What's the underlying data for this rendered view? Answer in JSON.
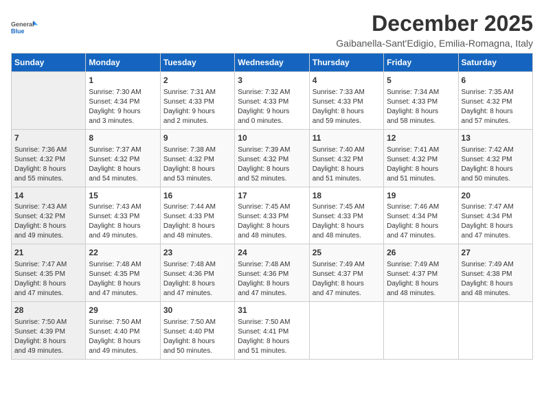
{
  "logo": {
    "line1": "General",
    "line2": "Blue"
  },
  "title": "December 2025",
  "subtitle": "Gaibanella-Sant'Edigio, Emilia-Romagna, Italy",
  "days_of_week": [
    "Sunday",
    "Monday",
    "Tuesday",
    "Wednesday",
    "Thursday",
    "Friday",
    "Saturday"
  ],
  "weeks": [
    [
      {
        "day": "",
        "info": ""
      },
      {
        "day": "1",
        "info": "Sunrise: 7:30 AM\nSunset: 4:34 PM\nDaylight: 9 hours\nand 3 minutes."
      },
      {
        "day": "2",
        "info": "Sunrise: 7:31 AM\nSunset: 4:33 PM\nDaylight: 9 hours\nand 2 minutes."
      },
      {
        "day": "3",
        "info": "Sunrise: 7:32 AM\nSunset: 4:33 PM\nDaylight: 9 hours\nand 0 minutes."
      },
      {
        "day": "4",
        "info": "Sunrise: 7:33 AM\nSunset: 4:33 PM\nDaylight: 8 hours\nand 59 minutes."
      },
      {
        "day": "5",
        "info": "Sunrise: 7:34 AM\nSunset: 4:33 PM\nDaylight: 8 hours\nand 58 minutes."
      },
      {
        "day": "6",
        "info": "Sunrise: 7:35 AM\nSunset: 4:32 PM\nDaylight: 8 hours\nand 57 minutes."
      }
    ],
    [
      {
        "day": "7",
        "info": "Sunrise: 7:36 AM\nSunset: 4:32 PM\nDaylight: 8 hours\nand 55 minutes."
      },
      {
        "day": "8",
        "info": "Sunrise: 7:37 AM\nSunset: 4:32 PM\nDaylight: 8 hours\nand 54 minutes."
      },
      {
        "day": "9",
        "info": "Sunrise: 7:38 AM\nSunset: 4:32 PM\nDaylight: 8 hours\nand 53 minutes."
      },
      {
        "day": "10",
        "info": "Sunrise: 7:39 AM\nSunset: 4:32 PM\nDaylight: 8 hours\nand 52 minutes."
      },
      {
        "day": "11",
        "info": "Sunrise: 7:40 AM\nSunset: 4:32 PM\nDaylight: 8 hours\nand 51 minutes."
      },
      {
        "day": "12",
        "info": "Sunrise: 7:41 AM\nSunset: 4:32 PM\nDaylight: 8 hours\nand 51 minutes."
      },
      {
        "day": "13",
        "info": "Sunrise: 7:42 AM\nSunset: 4:32 PM\nDaylight: 8 hours\nand 50 minutes."
      }
    ],
    [
      {
        "day": "14",
        "info": "Sunrise: 7:43 AM\nSunset: 4:32 PM\nDaylight: 8 hours\nand 49 minutes."
      },
      {
        "day": "15",
        "info": "Sunrise: 7:43 AM\nSunset: 4:33 PM\nDaylight: 8 hours\nand 49 minutes."
      },
      {
        "day": "16",
        "info": "Sunrise: 7:44 AM\nSunset: 4:33 PM\nDaylight: 8 hours\nand 48 minutes."
      },
      {
        "day": "17",
        "info": "Sunrise: 7:45 AM\nSunset: 4:33 PM\nDaylight: 8 hours\nand 48 minutes."
      },
      {
        "day": "18",
        "info": "Sunrise: 7:45 AM\nSunset: 4:33 PM\nDaylight: 8 hours\nand 48 minutes."
      },
      {
        "day": "19",
        "info": "Sunrise: 7:46 AM\nSunset: 4:34 PM\nDaylight: 8 hours\nand 47 minutes."
      },
      {
        "day": "20",
        "info": "Sunrise: 7:47 AM\nSunset: 4:34 PM\nDaylight: 8 hours\nand 47 minutes."
      }
    ],
    [
      {
        "day": "21",
        "info": "Sunrise: 7:47 AM\nSunset: 4:35 PM\nDaylight: 8 hours\nand 47 minutes."
      },
      {
        "day": "22",
        "info": "Sunrise: 7:48 AM\nSunset: 4:35 PM\nDaylight: 8 hours\nand 47 minutes."
      },
      {
        "day": "23",
        "info": "Sunrise: 7:48 AM\nSunset: 4:36 PM\nDaylight: 8 hours\nand 47 minutes."
      },
      {
        "day": "24",
        "info": "Sunrise: 7:48 AM\nSunset: 4:36 PM\nDaylight: 8 hours\nand 47 minutes."
      },
      {
        "day": "25",
        "info": "Sunrise: 7:49 AM\nSunset: 4:37 PM\nDaylight: 8 hours\nand 47 minutes."
      },
      {
        "day": "26",
        "info": "Sunrise: 7:49 AM\nSunset: 4:37 PM\nDaylight: 8 hours\nand 48 minutes."
      },
      {
        "day": "27",
        "info": "Sunrise: 7:49 AM\nSunset: 4:38 PM\nDaylight: 8 hours\nand 48 minutes."
      }
    ],
    [
      {
        "day": "28",
        "info": "Sunrise: 7:50 AM\nSunset: 4:39 PM\nDaylight: 8 hours\nand 49 minutes."
      },
      {
        "day": "29",
        "info": "Sunrise: 7:50 AM\nSunset: 4:40 PM\nDaylight: 8 hours\nand 49 minutes."
      },
      {
        "day": "30",
        "info": "Sunrise: 7:50 AM\nSunset: 4:40 PM\nDaylight: 8 hours\nand 50 minutes."
      },
      {
        "day": "31",
        "info": "Sunrise: 7:50 AM\nSunset: 4:41 PM\nDaylight: 8 hours\nand 51 minutes."
      },
      {
        "day": "",
        "info": ""
      },
      {
        "day": "",
        "info": ""
      },
      {
        "day": "",
        "info": ""
      }
    ]
  ]
}
